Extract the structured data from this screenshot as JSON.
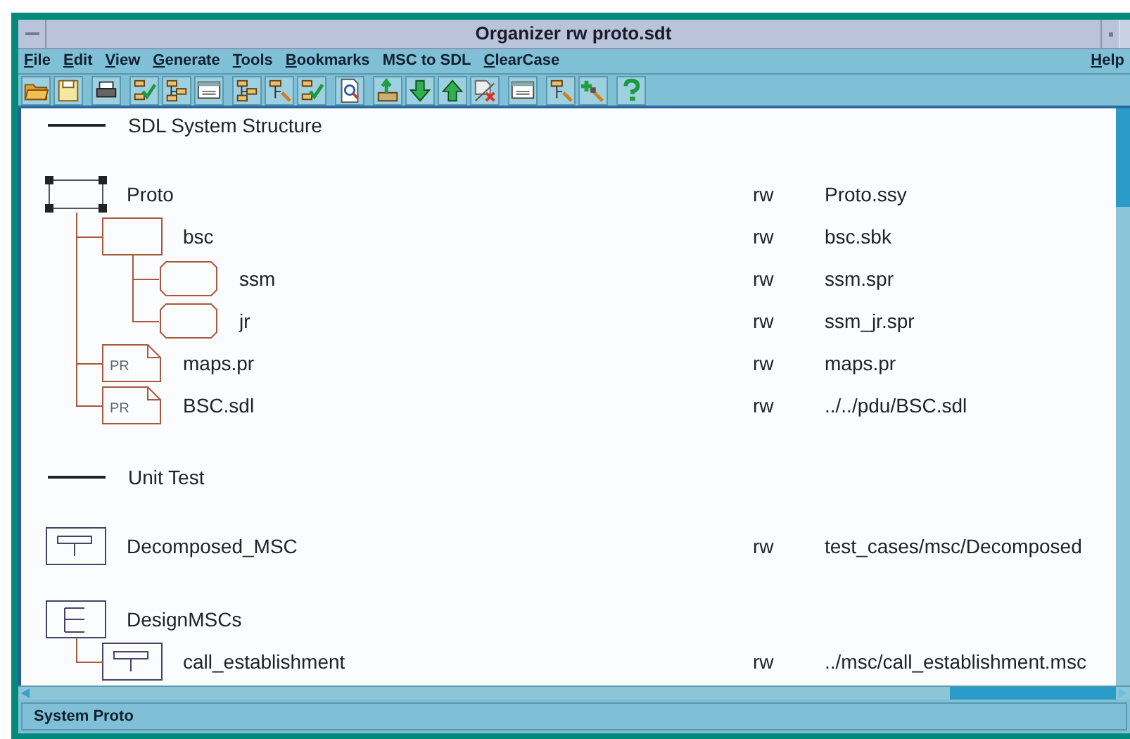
{
  "window": {
    "title": "Organizer rw proto.sdt"
  },
  "menu": {
    "left": [
      {
        "label": "File",
        "underlined": true
      },
      {
        "label": "Edit",
        "underlined": true
      },
      {
        "label": "View",
        "underlined": true
      },
      {
        "label": "Generate",
        "underlined": true
      },
      {
        "label": "Tools",
        "underlined": true
      },
      {
        "label": "Bookmarks",
        "underlined": true
      },
      {
        "label": "MSC to SDL",
        "underlined": false
      },
      {
        "label": "ClearCase",
        "underlined": true
      }
    ],
    "right": [
      {
        "label": "Help",
        "underlined": true
      }
    ]
  },
  "sections": [
    {
      "title": "SDL System Structure",
      "items": [
        {
          "kind": "system",
          "label": "Proto",
          "access": "rw",
          "file": "Proto.ssy",
          "selected": true,
          "children": [
            {
              "kind": "block",
              "label": "bsc",
              "access": "rw",
              "file": "bsc.sbk",
              "selected": false,
              "children": [
                {
                  "kind": "process",
                  "label": "ssm",
                  "access": "rw",
                  "file": "ssm.spr",
                  "selected": false
                },
                {
                  "kind": "process",
                  "label": "jr",
                  "access": "rw",
                  "file": "ssm_jr.spr",
                  "selected": false
                }
              ]
            },
            {
              "kind": "pr",
              "badge": "PR",
              "label": "maps.pr",
              "access": "rw",
              "file": "maps.pr",
              "selected": false
            },
            {
              "kind": "pr",
              "badge": "PR",
              "label": "BSC.sdl",
              "access": "rw",
              "file": "../../pdu/BSC.sdl",
              "selected": false
            }
          ]
        }
      ]
    },
    {
      "title": "Unit Test",
      "items": [
        {
          "kind": "msc",
          "label": "Decomposed_MSC",
          "access": "rw",
          "file": "test_cases/msc/Decomposed",
          "selected": false
        },
        {
          "kind": "msc_group",
          "label": "DesignMSCs",
          "selected": false,
          "children": [
            {
              "kind": "msc",
              "label": "call_establishment",
              "access": "rw",
              "file": "../msc/call_establishment.msc",
              "selected": false
            }
          ]
        }
      ]
    }
  ],
  "status_bar": "System Proto"
}
